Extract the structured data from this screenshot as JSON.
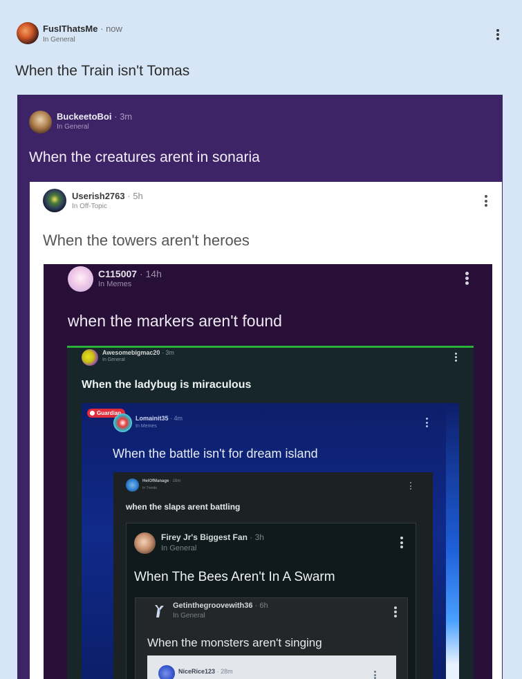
{
  "posts": [
    {
      "author": "FusIThatsMe",
      "time": "now",
      "category": "In General",
      "title": "When the Train isn't Tomas"
    },
    {
      "author": "BuckeetoBoi",
      "time": "3m",
      "category": "In General",
      "title": "When the creatures arent in sonaria"
    },
    {
      "author": "Userish2763",
      "time": "5h",
      "category": "In Off-Topic",
      "title": "When the towers aren't heroes"
    },
    {
      "author": "C115007",
      "time": "14h",
      "category": "In Memes",
      "title": "when the markers aren't found"
    },
    {
      "author": "Awesomebigmac20",
      "time": "3m",
      "category": "In General",
      "title": "When the ladybug is miraculous"
    },
    {
      "author": "Lomainit35",
      "time": "4m",
      "category": "In Memes",
      "badge": "Guardian",
      "title": "When the battle isn't for dream island"
    },
    {
      "author": "HelOfManage",
      "time": "16m",
      "category": "In Trends",
      "title": "when the slaps arent battling"
    },
    {
      "author": "Firey Jr's Biggest Fan",
      "time": "3h",
      "category": "In General",
      "title": "When The Bees Aren't In A Swarm"
    },
    {
      "author": "Getinthegroovewith36",
      "time": "6h",
      "category": "In General",
      "title": "When the monsters aren't singing"
    },
    {
      "author": "NiceRice123",
      "time": "28m",
      "category": "",
      "title": ""
    }
  ],
  "separator": "·",
  "colors": {
    "page_bg": "#d6e6f7",
    "card_purple": "#3d2466",
    "card_white": "#ffffff",
    "card_dark_purple": "#280f38",
    "card_dark_teal": "#16262a",
    "accent_green": "#2bb03a",
    "card_blue": "#0d1e6a",
    "badge_red": "#e32d3b"
  },
  "icons": {
    "menu": "kebab-menu-icon",
    "badge": "guardian-badge-icon"
  }
}
